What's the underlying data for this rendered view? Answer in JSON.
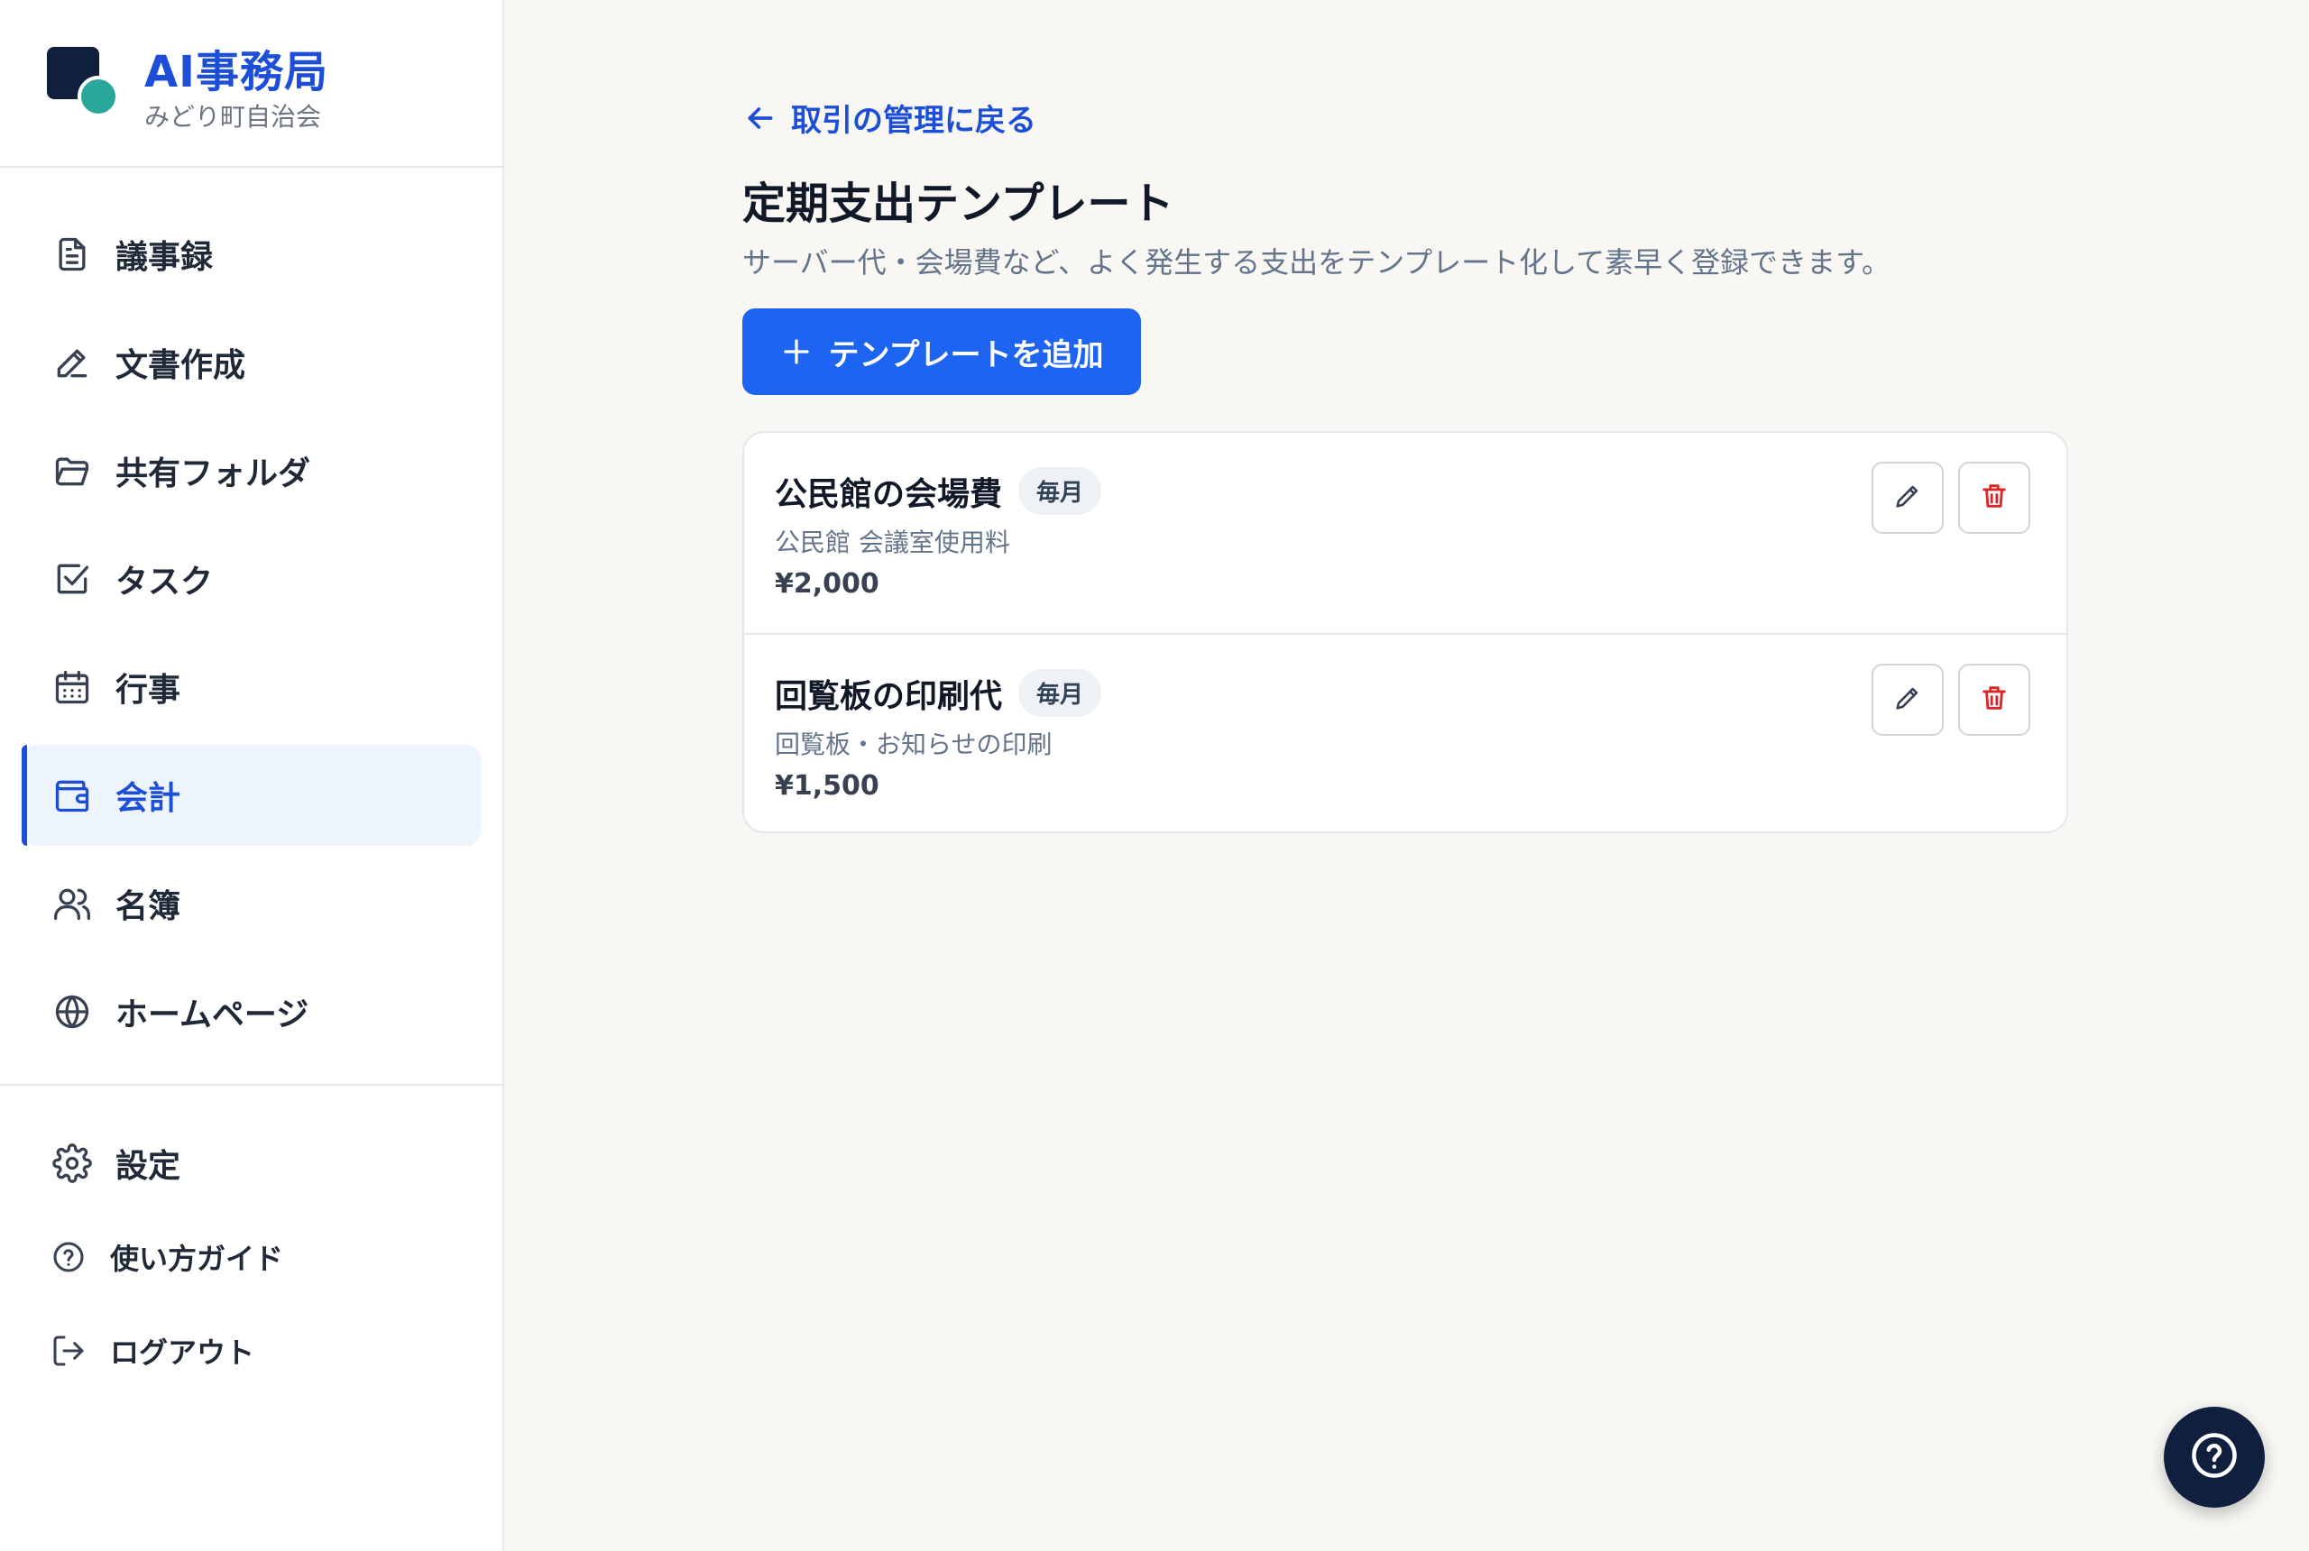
{
  "brand": {
    "title": "AI事務局",
    "subtitle": "みどり町自治会"
  },
  "nav": {
    "items": [
      {
        "label": "議事録",
        "icon": "document-icon"
      },
      {
        "label": "文書作成",
        "icon": "pencil-icon"
      },
      {
        "label": "共有フォルダ",
        "icon": "folder-icon"
      },
      {
        "label": "タスク",
        "icon": "checkbox-icon"
      },
      {
        "label": "行事",
        "icon": "calendar-icon"
      },
      {
        "label": "会計",
        "icon": "wallet-icon",
        "active": true
      },
      {
        "label": "名簿",
        "icon": "users-icon"
      },
      {
        "label": "ホームページ",
        "icon": "globe-icon"
      }
    ],
    "bottom": [
      {
        "label": "設定",
        "icon": "gear-icon"
      },
      {
        "label": "使い方ガイド",
        "icon": "help-circle-icon"
      },
      {
        "label": "ログアウト",
        "icon": "logout-icon"
      }
    ]
  },
  "main": {
    "back_label": "取引の管理に戻る",
    "title": "定期支出テンプレート",
    "description": "サーバー代・会場費など、よく発生する支出をテンプレート化して素早く登録できます。",
    "add_button_label": "テンプレートを追加",
    "templates": [
      {
        "name": "公民館の会場費",
        "frequency": "毎月",
        "description": "公民館 会議室使用料",
        "amount": "¥2,000"
      },
      {
        "name": "回覧板の印刷代",
        "frequency": "毎月",
        "description": "回覧板・お知らせの印刷",
        "amount": "¥1,500"
      }
    ]
  },
  "colors": {
    "accent": "#1d64f2",
    "brand_text": "#1d4ed8",
    "logo_dark": "#0f1f3d",
    "logo_teal": "#2aa79b",
    "danger": "#dc2626",
    "background": "#f8f7f4"
  }
}
